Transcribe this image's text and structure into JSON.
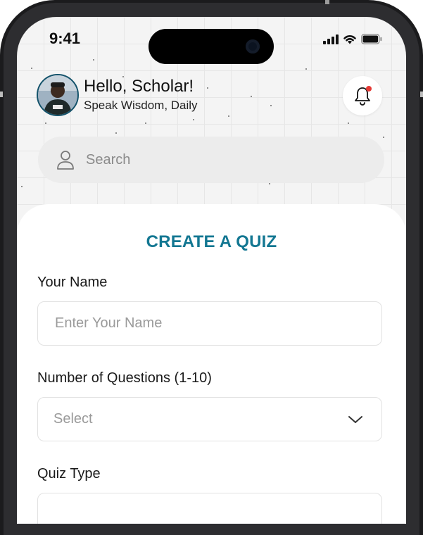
{
  "status_bar": {
    "time": "9:41"
  },
  "header": {
    "greeting": "Hello, Scholar!",
    "subtitle": "Speak Wisdom, Daily",
    "avatar_icon": "user-avatar-photo",
    "bell_icon": "bell-icon",
    "notification_color": "#e53935"
  },
  "search": {
    "placeholder": "Search",
    "value": "",
    "icon": "person-icon"
  },
  "quiz_form": {
    "title": "CREATE A QUIZ",
    "title_color": "#137792",
    "name": {
      "label": "Your Name",
      "placeholder": "Enter Your Name",
      "value": ""
    },
    "questions": {
      "label": "Number of Questions (1-10)",
      "selected": "Select"
    },
    "quiz_type": {
      "label": "Quiz Type"
    }
  }
}
